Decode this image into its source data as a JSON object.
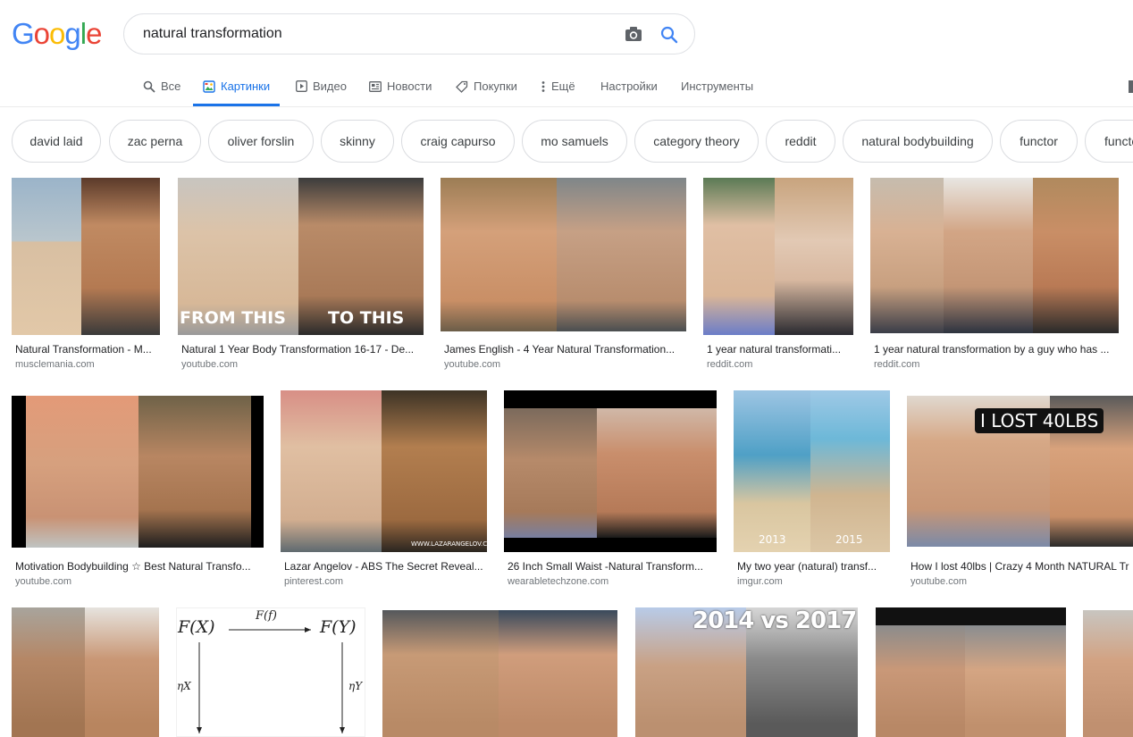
{
  "logo": {
    "letters": [
      "G",
      "o",
      "o",
      "g",
      "l",
      "e"
    ],
    "colors": [
      "#4285f4",
      "#ea4335",
      "#fbbc05",
      "#4285f4",
      "#34a853",
      "#ea4335"
    ]
  },
  "search": {
    "query": "natural transformation",
    "placeholder": ""
  },
  "icons": {
    "camera": "camera-icon",
    "search": "search-icon"
  },
  "tabs": [
    {
      "label": "Все",
      "icon": "search-icon",
      "active": false
    },
    {
      "label": "Картинки",
      "icon": "image-icon",
      "active": true
    },
    {
      "label": "Видео",
      "icon": "video-icon",
      "active": false
    },
    {
      "label": "Новости",
      "icon": "news-icon",
      "active": false
    },
    {
      "label": "Покупки",
      "icon": "tag-icon",
      "active": false
    },
    {
      "label": "Ещё",
      "icon": "more-vert-icon",
      "active": false
    },
    {
      "label": "Настройки",
      "active": false
    },
    {
      "label": "Инструменты",
      "active": false
    }
  ],
  "chips": [
    "david laid",
    "zac perna",
    "oliver forslin",
    "skinny",
    "craig capurso",
    "mo samuels",
    "category theory",
    "reddit",
    "natural bodybuilding",
    "functor",
    "functor"
  ],
  "results": [
    {
      "caption": "Natural Transformation - M...",
      "source": "musclemania.com"
    },
    {
      "caption": "Natural 1 Year Body Transformation 16-17 - De...",
      "source": "youtube.com",
      "overlay_left": "FROM THIS",
      "overlay_right": "TO THIS"
    },
    {
      "caption": "James English - 4 Year Natural Transformation...",
      "source": "youtube.com"
    },
    {
      "caption": "1 year natural transformati...",
      "source": "reddit.com"
    },
    {
      "caption": "1 year natural transformation by a guy who has ...",
      "source": "reddit.com"
    },
    {
      "caption": "Motivation Bodybuilding ☆ Best Natural Transfo...",
      "source": "youtube.com"
    },
    {
      "caption": "Lazar Angelov - ABS The Secret Reveal...",
      "source": "pinterest.com",
      "watermark": "WWW.LAZARANGELOV.COM"
    },
    {
      "caption": "26 Inch Small Waist -Natural Transform...",
      "source": "wearabletechzone.com"
    },
    {
      "caption": "My two year (natural) transf...",
      "source": "imgur.com",
      "year_left": "2013",
      "year_right": "2015"
    },
    {
      "caption": "How I lost 40lbs | Crazy 4 Month NATURAL Tr",
      "source": "youtube.com",
      "overlay": "I LOST 40LBS"
    },
    {
      "caption": "",
      "source": ""
    },
    {
      "caption": "",
      "source": "",
      "math": {
        "fx": "F(X)",
        "ff": "F(f)",
        "fy": "F(Y)",
        "eta_x": "ηX",
        "eta_y": "ηY"
      }
    },
    {
      "caption": "",
      "source": ""
    },
    {
      "caption": "",
      "source": "",
      "overlay": "2014 vs 2017"
    },
    {
      "caption": "",
      "source": ""
    },
    {
      "caption": "",
      "source": ""
    }
  ]
}
